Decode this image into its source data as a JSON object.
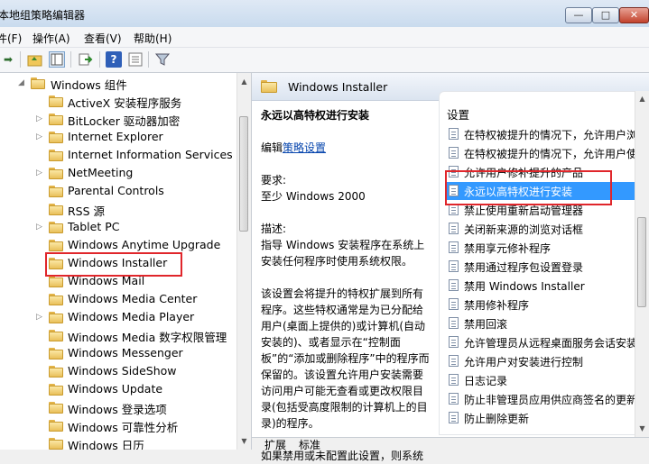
{
  "window": {
    "title": "本地组策略编辑器",
    "controls": {
      "minimize": "—",
      "maximize": "□",
      "close": "✕"
    }
  },
  "menu": [
    "件(F)",
    "操作(A)",
    "查看(V)",
    "帮助(H)"
  ],
  "toolbar": {
    "icons": [
      "forward-icon",
      "up-folder-icon",
      "show-tree-icon",
      "export-icon",
      "help-icon",
      "properties-icon",
      "filter-icon"
    ]
  },
  "tree": {
    "parent": "Windows 组件",
    "items": [
      {
        "label": "ActiveX 安装程序服务",
        "expandable": false
      },
      {
        "label": "BitLocker 驱动器加密",
        "expandable": true
      },
      {
        "label": "Internet Explorer",
        "expandable": true
      },
      {
        "label": "Internet Information Services",
        "expandable": false
      },
      {
        "label": "NetMeeting",
        "expandable": true
      },
      {
        "label": "Parental Controls",
        "expandable": false
      },
      {
        "label": "RSS 源",
        "expandable": false
      },
      {
        "label": "Tablet PC",
        "expandable": true
      },
      {
        "label": "Windows Anytime Upgrade",
        "expandable": false
      },
      {
        "label": "Windows Installer",
        "expandable": false,
        "highlighted": true
      },
      {
        "label": "Windows Mail",
        "expandable": false
      },
      {
        "label": "Windows Media Center",
        "expandable": false
      },
      {
        "label": "Windows Media Player",
        "expandable": true
      },
      {
        "label": "Windows Media 数字权限管理",
        "expandable": false
      },
      {
        "label": "Windows Messenger",
        "expandable": false
      },
      {
        "label": "Windows SideShow",
        "expandable": false
      },
      {
        "label": "Windows Update",
        "expandable": false
      },
      {
        "label": "Windows 登录选项",
        "expandable": false
      },
      {
        "label": "Windows 可靠性分析",
        "expandable": false
      },
      {
        "label": "Windows 日历",
        "expandable": false
      }
    ]
  },
  "right": {
    "header": "Windows Installer",
    "policy_title": "永远以高特权进行安装",
    "edit_prefix": "编辑",
    "edit_link": "策略设置",
    "req_label": "要求:",
    "req_value": "至少 Windows 2000",
    "desc_label": "描述:",
    "desc_text": "指导 Windows 安装程序在系统上安装任何程序时使用系统权限。",
    "desc_more": "该设置会将提升的特权扩展到所有程序。这些特权通常是为已分配给用户(桌面上提供的)或计算机(自动安装的)、或者显示在“控制面板”的“添加或删除程序”中的程序而保留的。该设置允许用户安装需要访问用户可能无查看或更改权限目录(包括受高度限制的计算机上的目录)的程序。",
    "desc_tail": "如果禁用或未配置此设置，则系统",
    "settings_header": "设置",
    "settings": [
      {
        "label": "在特权被提升的情况下，允许用户浏"
      },
      {
        "label": "在特权被提升的情况下，允许用户使"
      },
      {
        "label": "允许用户修补提升的产品"
      },
      {
        "label": "永远以高特权进行安装",
        "selected": true
      },
      {
        "label": "禁止使用重新启动管理器"
      },
      {
        "label": "关闭新来源的浏览对话框"
      },
      {
        "label": "禁用享元修补程序"
      },
      {
        "label": "禁用通过程序包设置登录"
      },
      {
        "label": "禁用 Windows Installer"
      },
      {
        "label": "禁用修补程序"
      },
      {
        "label": "禁用回滚"
      },
      {
        "label": "允许管理员从远程桌面服务会话安装"
      },
      {
        "label": "允许用户对安装进行控制"
      },
      {
        "label": "日志记录"
      },
      {
        "label": "防止非管理员应用供应商签名的更新"
      },
      {
        "label": "防止删除更新"
      }
    ],
    "tabs": [
      "扩展",
      "标准"
    ]
  },
  "colors": {
    "highlight": "#e0262b",
    "selection": "#3399ff",
    "link": "#0645ad"
  }
}
